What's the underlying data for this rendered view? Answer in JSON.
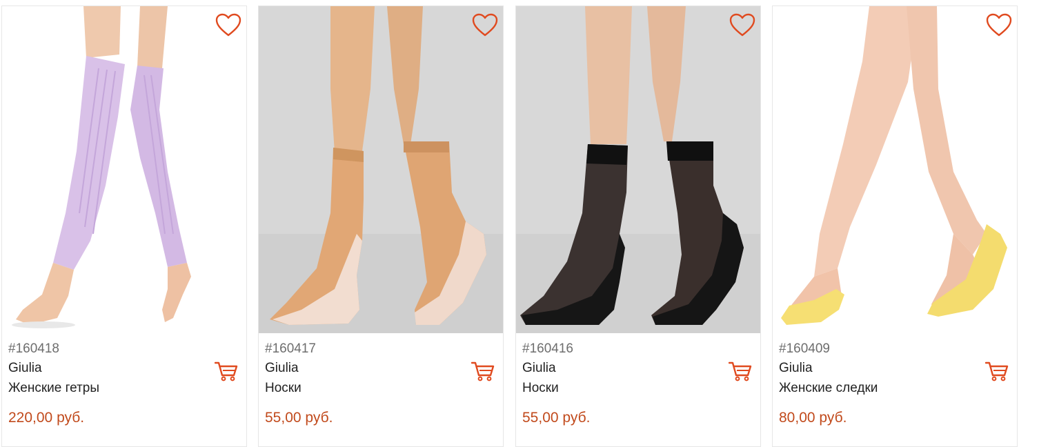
{
  "colors": {
    "accent": "#e04a1f",
    "price": "#c14a1c",
    "sku": "#6d6d6d",
    "text": "#222222"
  },
  "products": [
    {
      "sku": "#160418",
      "brand": "Giulia",
      "name": "Женские гетры",
      "price": "220,00 руб.",
      "favorite_icon": "heart-outline-icon",
      "cart_icon": "cart-icon"
    },
    {
      "sku": "#160417",
      "brand": "Giulia",
      "name": "Носки",
      "price": "55,00 руб.",
      "favorite_icon": "heart-outline-icon",
      "cart_icon": "cart-icon"
    },
    {
      "sku": "#160416",
      "brand": "Giulia",
      "name": "Носки",
      "price": "55,00 руб.",
      "favorite_icon": "heart-outline-icon",
      "cart_icon": "cart-icon"
    },
    {
      "sku": "#160409",
      "brand": "Giulia",
      "name": "Женские следки",
      "price": "80,00 руб.",
      "favorite_icon": "heart-outline-icon",
      "cart_icon": "cart-icon"
    }
  ]
}
